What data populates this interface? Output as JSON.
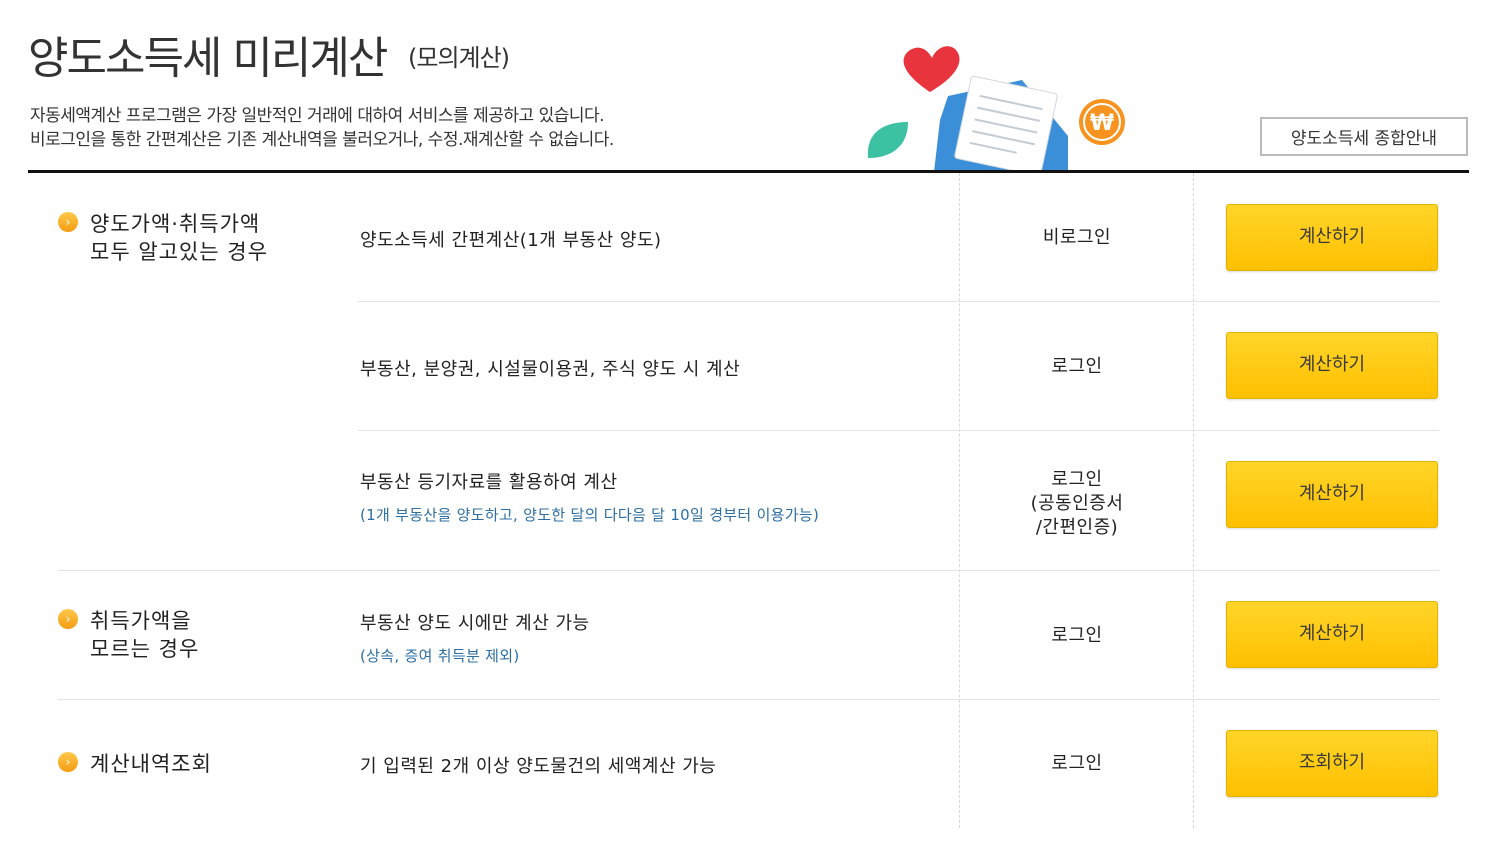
{
  "header": {
    "title": "양도소득세 미리계산",
    "title_sub": "(모의계산)",
    "desc_line1": "자동세액계산 프로그램은 가장 일반적인 거래에 대하여 서비스를 제공하고 있습니다.",
    "desc_line2": "비로그인을 통한 간편계산은 기존 계산내역을 불러오거나, 수정.재계산할 수 없습니다.",
    "guide_button": "양도소득세 종합안내"
  },
  "categories": [
    {
      "line1": "양도가액·취득가액",
      "line2": "모두 알고있는 경우"
    },
    {
      "line1": "취득가액을",
      "line2": "모르는 경우"
    },
    {
      "line1": "계산내역조회",
      "line2": ""
    }
  ],
  "rows": [
    {
      "main": "양도소득세 간편계산(1개 부동산 양도)",
      "sub": "",
      "auth_lines": [
        "비로그인"
      ],
      "button": "계산하기"
    },
    {
      "main": "부동산, 분양권, 시설물이용권, 주식 양도 시 계산",
      "sub": "",
      "auth_lines": [
        "로그인"
      ],
      "button": "계산하기"
    },
    {
      "main": "부동산 등기자료를 활용하여 계산",
      "sub": "(1개 부동산을 양도하고, 양도한 달의 다다음 달 10일 경부터 이용가능)",
      "auth_lines": [
        "로그인",
        "(공동인증서",
        "/간편인증)"
      ],
      "button": "계산하기"
    },
    {
      "main": "부동산 양도 시에만 계산 가능",
      "sub": "(상속, 증여 취득분 제외)",
      "auth_lines": [
        "로그인"
      ],
      "button": "계산하기"
    },
    {
      "main": "기 입력된 2개 이상 양도물건의 세액계산 가능",
      "sub": "",
      "auth_lines": [
        "로그인"
      ],
      "button": "조회하기"
    }
  ],
  "icons": {
    "bullet": "chevron-right-icon",
    "illustration": [
      "heart-icon",
      "leaf-icon",
      "envelope-icon",
      "won-coin-icon"
    ]
  },
  "colors": {
    "button_yellow": "#ffc000",
    "bullet_orange": "#f39c12",
    "sub_text_blue": "#2d6fa3"
  }
}
